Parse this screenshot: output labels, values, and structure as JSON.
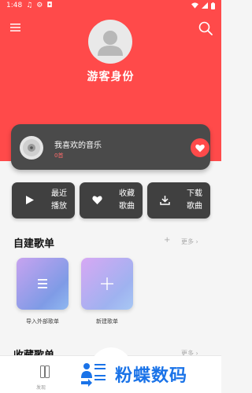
{
  "status_bar": {
    "time": "1:48"
  },
  "header": {
    "username": "游客身份"
  },
  "favorites_card": {
    "title": "我喜欢的音乐",
    "count": "0首"
  },
  "quick_actions": [
    {
      "label": "最近播放",
      "icon": "play-icon"
    },
    {
      "label": "收藏歌曲",
      "icon": "heart-icon"
    },
    {
      "label": "下载歌曲",
      "icon": "download-icon"
    }
  ],
  "created_playlists": {
    "title": "自建歌单",
    "more_label": "更多 ›",
    "add_label": "+",
    "items": [
      {
        "label": "导入外部歌单",
        "icon": "list-icon"
      },
      {
        "label": "新建歌单",
        "icon": "plus-icon"
      }
    ]
  },
  "collected_playlists": {
    "title": "收藏歌单",
    "more_label": "更多 ›"
  },
  "bottom_nav": {
    "tab_label": "发现"
  },
  "watermark": {
    "text": "粉蝶数码"
  },
  "colors": {
    "brand": "#ff4a4a",
    "card": "#4a4a4a",
    "quick_card": "#404040",
    "watermark": "#1a73e8"
  }
}
